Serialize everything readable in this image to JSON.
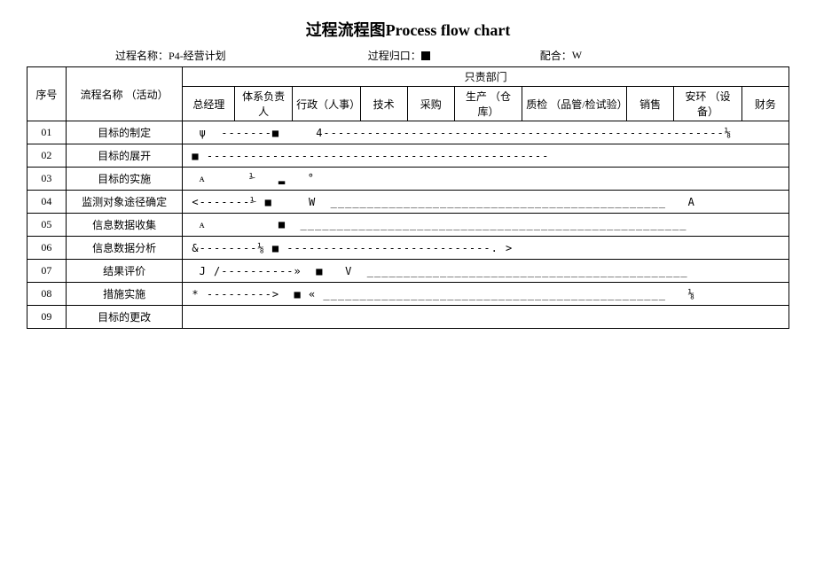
{
  "title": "过程流程图Process flow chart",
  "meta": {
    "processNameLabel": "过程名称：",
    "processNameValue": "P4-经营计划",
    "processOwnerLabel": "过程归口：",
    "processOwnerValue": "",
    "coopLabel": "配合：",
    "coopValue": "W"
  },
  "headers": {
    "col_seq": "序号",
    "col_activity": "流程名称 （活动）",
    "col_dept_group": "只责部门",
    "col_gm": "总经理",
    "col_sys": "体系负责人",
    "col_admin": "行政（人事）",
    "col_tech": "技术",
    "col_purchase": "采购",
    "col_prod": "生产 （仓库）",
    "col_qc": "质检\n（品管/检试验）",
    "col_sales": "销售",
    "col_safety": "安环 （设备）",
    "col_finance": "财务"
  },
  "rows": [
    {
      "seq": "01",
      "activity": "目标的制定",
      "flow": " ψ  -------■     4-------------------------------------------------------⅛"
    },
    {
      "seq": "02",
      "activity": "目标的展开",
      "flow": "■ -----------------------------------------------"
    },
    {
      "seq": "03",
      "activity": "目标的实施",
      "flow": " ᴀ      ⅟   ▂   °"
    },
    {
      "seq": "04",
      "activity": "监测对象途径确定",
      "flow": "<-------⅟ ■     W  ______________________________________________   A"
    },
    {
      "seq": "05",
      "activity": "信息数据收集",
      "flow": " ᴀ          ■  _____________________________________________________"
    },
    {
      "seq": "06",
      "activity": "信息数据分析",
      "flow": "&--------⅛ ■ ----------------------------. >"
    },
    {
      "seq": "07",
      "activity": "结果评价",
      "flow": " J /----------»  ■   V  ____________________________________________"
    },
    {
      "seq": "08",
      "activity": "措施实施",
      "flow": "* --------->  ■ « _______________________________________________   ⅛"
    },
    {
      "seq": "09",
      "activity": "目标的更改",
      "flow": ""
    }
  ]
}
